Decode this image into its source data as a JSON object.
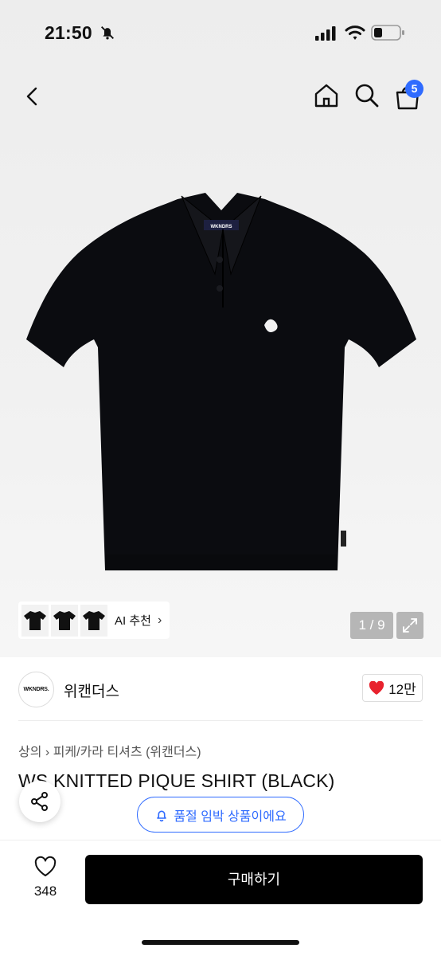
{
  "status_bar": {
    "time": "21:50",
    "icons": [
      "mute-bell-icon",
      "signal-icon",
      "wifi-icon",
      "battery-icon"
    ]
  },
  "nav": {
    "icons": [
      "back-icon",
      "home-icon",
      "search-icon",
      "cart-icon"
    ],
    "cart_count": "5"
  },
  "gallery": {
    "ai_recommend_label": "AI 추천",
    "page_indicator": "1 / 9",
    "shirt_logo_text": "WKNDRS"
  },
  "brand": {
    "logo_text": "WKNDRS.",
    "name": "위캔더스",
    "likes": "12만"
  },
  "product": {
    "breadcrumb": [
      "상의",
      "피케/카라 티셔츠 (위캔더스)"
    ],
    "title": "WS KNITTED PIQUE SHIRT (BLACK)"
  },
  "stock_notice": "품절 임박 상품이에요",
  "bottom_bar": {
    "wishlist_count": "348",
    "buy_label": "구매하기"
  },
  "colors": {
    "accent": "#2f6bff",
    "heart": "#e8222e",
    "button": "#000000"
  }
}
